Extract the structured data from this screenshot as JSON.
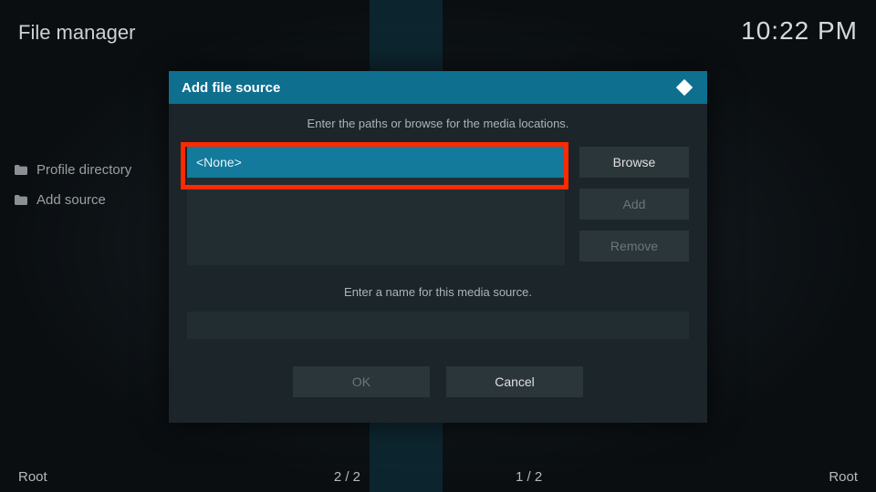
{
  "header": {
    "title": "File manager",
    "clock": "10:22 PM"
  },
  "sidebar": {
    "items": [
      {
        "label": "Profile directory"
      },
      {
        "label": "Add source"
      }
    ]
  },
  "dialog": {
    "title": "Add file source",
    "instruction": "Enter the paths or browse for the media locations.",
    "path_value": "<None>",
    "browse": "Browse",
    "add": "Add",
    "remove": "Remove",
    "name_label": "Enter a name for this media source.",
    "name_value": "",
    "ok": "OK",
    "cancel": "Cancel"
  },
  "footer": {
    "left_root": "Root",
    "left_count": "2 / 2",
    "right_count": "1 / 2",
    "right_root": "Root"
  }
}
